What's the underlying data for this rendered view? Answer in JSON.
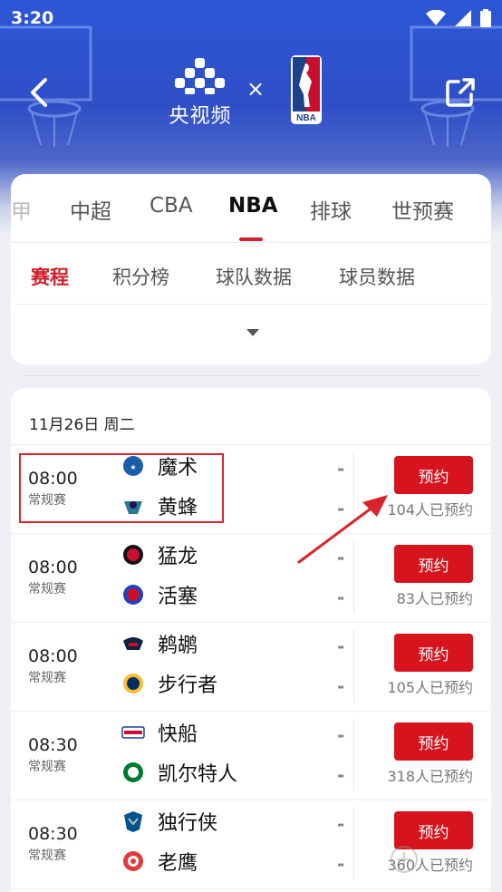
{
  "status": {
    "time": "3:20"
  },
  "header": {
    "cctv_label": "央视频",
    "times_symbol": "×",
    "nba_text": "NBA"
  },
  "sport_tabs": [
    {
      "label": "甲",
      "active": false
    },
    {
      "label": "中超",
      "active": false
    },
    {
      "label": "CBA",
      "active": false
    },
    {
      "label": "NBA",
      "active": true
    },
    {
      "label": "排球",
      "active": false
    },
    {
      "label": "世预赛",
      "active": false
    }
  ],
  "sub_tabs": [
    {
      "label": "赛程",
      "active": true
    },
    {
      "label": "积分榜",
      "active": false
    },
    {
      "label": "球队数据",
      "active": false
    },
    {
      "label": "球员数据",
      "active": false
    }
  ],
  "date": "11月26日 周二",
  "matches": [
    {
      "time": "08:00",
      "type": "常规赛",
      "home": "魔术",
      "away": "黄蜂",
      "home_score": "-",
      "away_score": "-",
      "button": "预约",
      "count": "104人已预约",
      "home_color": "#1a5dab",
      "away_color": "#2a7a8c"
    },
    {
      "time": "08:00",
      "type": "常规赛",
      "home": "猛龙",
      "away": "活塞",
      "home_score": "-",
      "away_score": "-",
      "button": "预约",
      "count": "83人已预约",
      "home_color": "#c8102e",
      "away_color": "#1d42ba"
    },
    {
      "time": "08:00",
      "type": "常规赛",
      "home": "鹈鹕",
      "away": "步行者",
      "home_score": "-",
      "away_score": "-",
      "button": "预约",
      "count": "105人已预约",
      "home_color": "#0c2340",
      "away_color": "#fdbb30"
    },
    {
      "time": "08:30",
      "type": "常规赛",
      "home": "快船",
      "away": "凯尔特人",
      "home_score": "-",
      "away_score": "-",
      "button": "预约",
      "count": "318人已预约",
      "home_color": "#1d428a",
      "away_color": "#007a33"
    },
    {
      "time": "08:30",
      "type": "常规赛",
      "home": "独行侠",
      "away": "老鹰",
      "home_score": "-",
      "away_score": "-",
      "button": "预约",
      "count": "360人已预约",
      "home_color": "#00538c",
      "away_color": "#e03a3e"
    }
  ],
  "colors": {
    "accent": "#d0202d",
    "button": "#d7141e",
    "header": "#2c56d6"
  }
}
